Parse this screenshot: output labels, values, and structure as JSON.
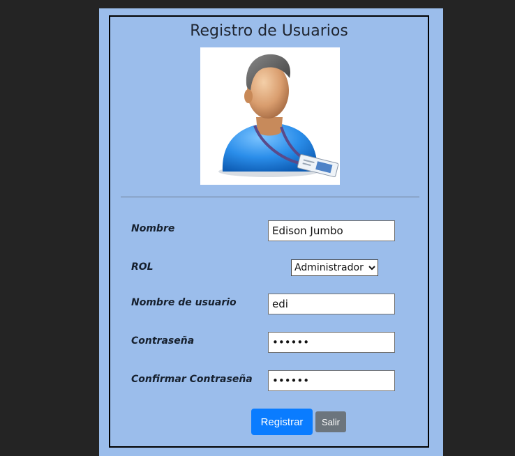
{
  "form": {
    "title": "Registro de Usuarios",
    "fields": {
      "nombre": {
        "label": "Nombre",
        "value": "Edison Jumbo"
      },
      "rol": {
        "label": "ROL",
        "selected": "Administrador"
      },
      "usuario": {
        "label": "Nombre de usuario",
        "value": "edi"
      },
      "contrasena": {
        "label": "Contraseña",
        "value": "123456"
      },
      "confirmar": {
        "label": "Confirmar Contraseña",
        "value": "123456"
      }
    },
    "buttons": {
      "registrar": "Registrar",
      "salir": "Salir"
    }
  },
  "colors": {
    "page_bg": "#242424",
    "panel_bg": "#9bbdeb",
    "primary": "#0a7cff",
    "secondary": "#6c757d"
  },
  "icons": {
    "avatar": "user-with-id-badge-icon"
  }
}
